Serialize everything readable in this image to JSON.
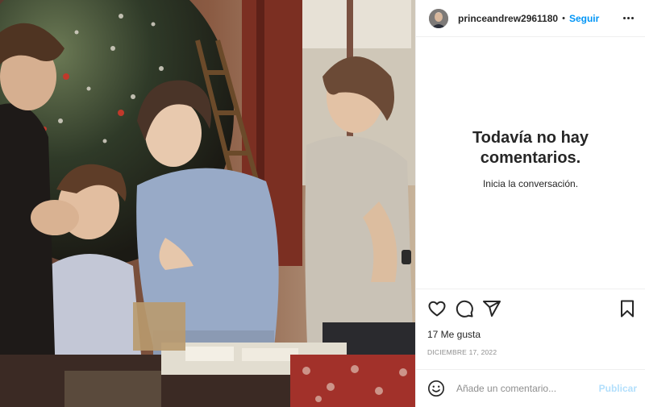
{
  "post": {
    "username": "princeandrew2961180",
    "separator": "•",
    "follow_label": "Seguir",
    "more_icon": "more-horizontal-icon"
  },
  "comments": {
    "empty_title": "Todavía no hay comentarios.",
    "empty_subtitle": "Inicia la conversación."
  },
  "actions": {
    "icons": [
      "heart-icon",
      "comment-icon",
      "share-icon",
      "bookmark-icon"
    ]
  },
  "likes_label": "17 Me gusta",
  "date_label": "DICIEMBRE 17, 2022",
  "add_comment": {
    "placeholder": "Añade un comentario...",
    "publish_label": "Publicar",
    "emoji_icon": "emoji-icon"
  },
  "colors": {
    "link_blue": "#0095f6",
    "publish_disabled": "#b2dffc",
    "border": "#efefef",
    "muted": "#8e8e8e"
  }
}
